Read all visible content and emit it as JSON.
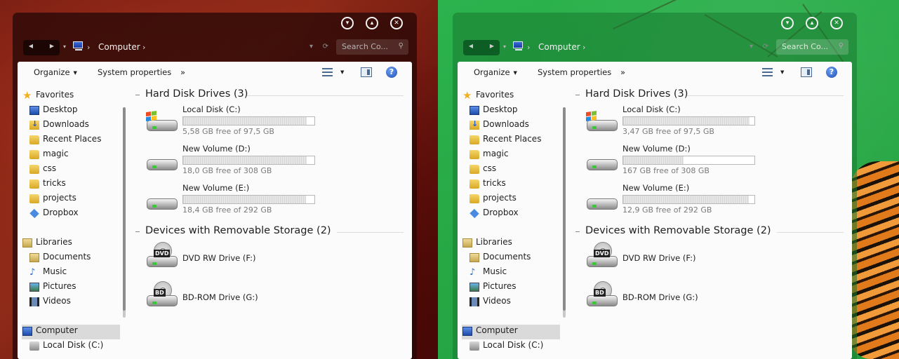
{
  "windows": [
    {
      "theme": "red",
      "caption_buttons": [
        "minimize-icon",
        "maximize-icon",
        "close-icon"
      ],
      "breadcrumb": {
        "location": "Computer"
      },
      "search": {
        "placeholder": "Search Co..."
      },
      "toolbar": {
        "organize": "Organize",
        "system_properties": "System properties",
        "more": "»"
      },
      "navigation": {
        "favorites": "Favorites",
        "favorite_items": [
          "Desktop",
          "Downloads",
          "Recent Places",
          "magic",
          "css",
          "tricks",
          "projects",
          "Dropbox"
        ],
        "libraries": "Libraries",
        "library_items": [
          "Documents",
          "Music",
          "Pictures",
          "Videos"
        ],
        "computer": "Computer",
        "computer_items": [
          "Local Disk (C:)"
        ]
      },
      "groups": {
        "hard_disks": "Hard Disk Drives (3)",
        "removable": "Devices with Removable Storage (2)"
      },
      "drives": [
        {
          "name": "Local Disk (C:)",
          "free": "5,58 GB free of 97,5 GB",
          "used_fraction": 0.943
        },
        {
          "name": "New Volume (D:)",
          "free": "18,0 GB free of 308 GB",
          "used_fraction": 0.942
        },
        {
          "name": "New Volume (E:)",
          "free": "18,4 GB free of 292 GB",
          "used_fraction": 0.937
        }
      ],
      "removable": [
        {
          "name": "DVD RW Drive (F:)",
          "badge": "DVD"
        },
        {
          "name": "BD-ROM Drive (G:)",
          "badge": "BD"
        }
      ]
    },
    {
      "theme": "green",
      "caption_buttons": [
        "minimize-icon",
        "maximize-icon",
        "close-icon"
      ],
      "breadcrumb": {
        "location": "Computer"
      },
      "search": {
        "placeholder": "Search Co..."
      },
      "toolbar": {
        "organize": "Organize",
        "system_properties": "System properties",
        "more": "»"
      },
      "navigation": {
        "favorites": "Favorites",
        "favorite_items": [
          "Desktop",
          "Downloads",
          "Recent Places",
          "magic",
          "css",
          "tricks",
          "projects",
          "Dropbox"
        ],
        "libraries": "Libraries",
        "library_items": [
          "Documents",
          "Music",
          "Pictures",
          "Videos"
        ],
        "computer": "Computer",
        "computer_items": [
          "Local Disk (C:)"
        ]
      },
      "groups": {
        "hard_disks": "Hard Disk Drives (3)",
        "removable": "Devices with Removable Storage (2)"
      },
      "drives": [
        {
          "name": "Local Disk (C:)",
          "free": "3,47 GB free of 97,5 GB",
          "used_fraction": 0.964
        },
        {
          "name": "New Volume (D:)",
          "free": "167 GB free of 308 GB",
          "used_fraction": 0.458
        },
        {
          "name": "New Volume (E:)",
          "free": "12,9 GB free of 292 GB",
          "used_fraction": 0.956
        }
      ],
      "removable": [
        {
          "name": "DVD RW Drive (F:)",
          "badge": "DVD"
        },
        {
          "name": "BD-ROM Drive (G:)",
          "badge": "BD"
        }
      ]
    }
  ]
}
